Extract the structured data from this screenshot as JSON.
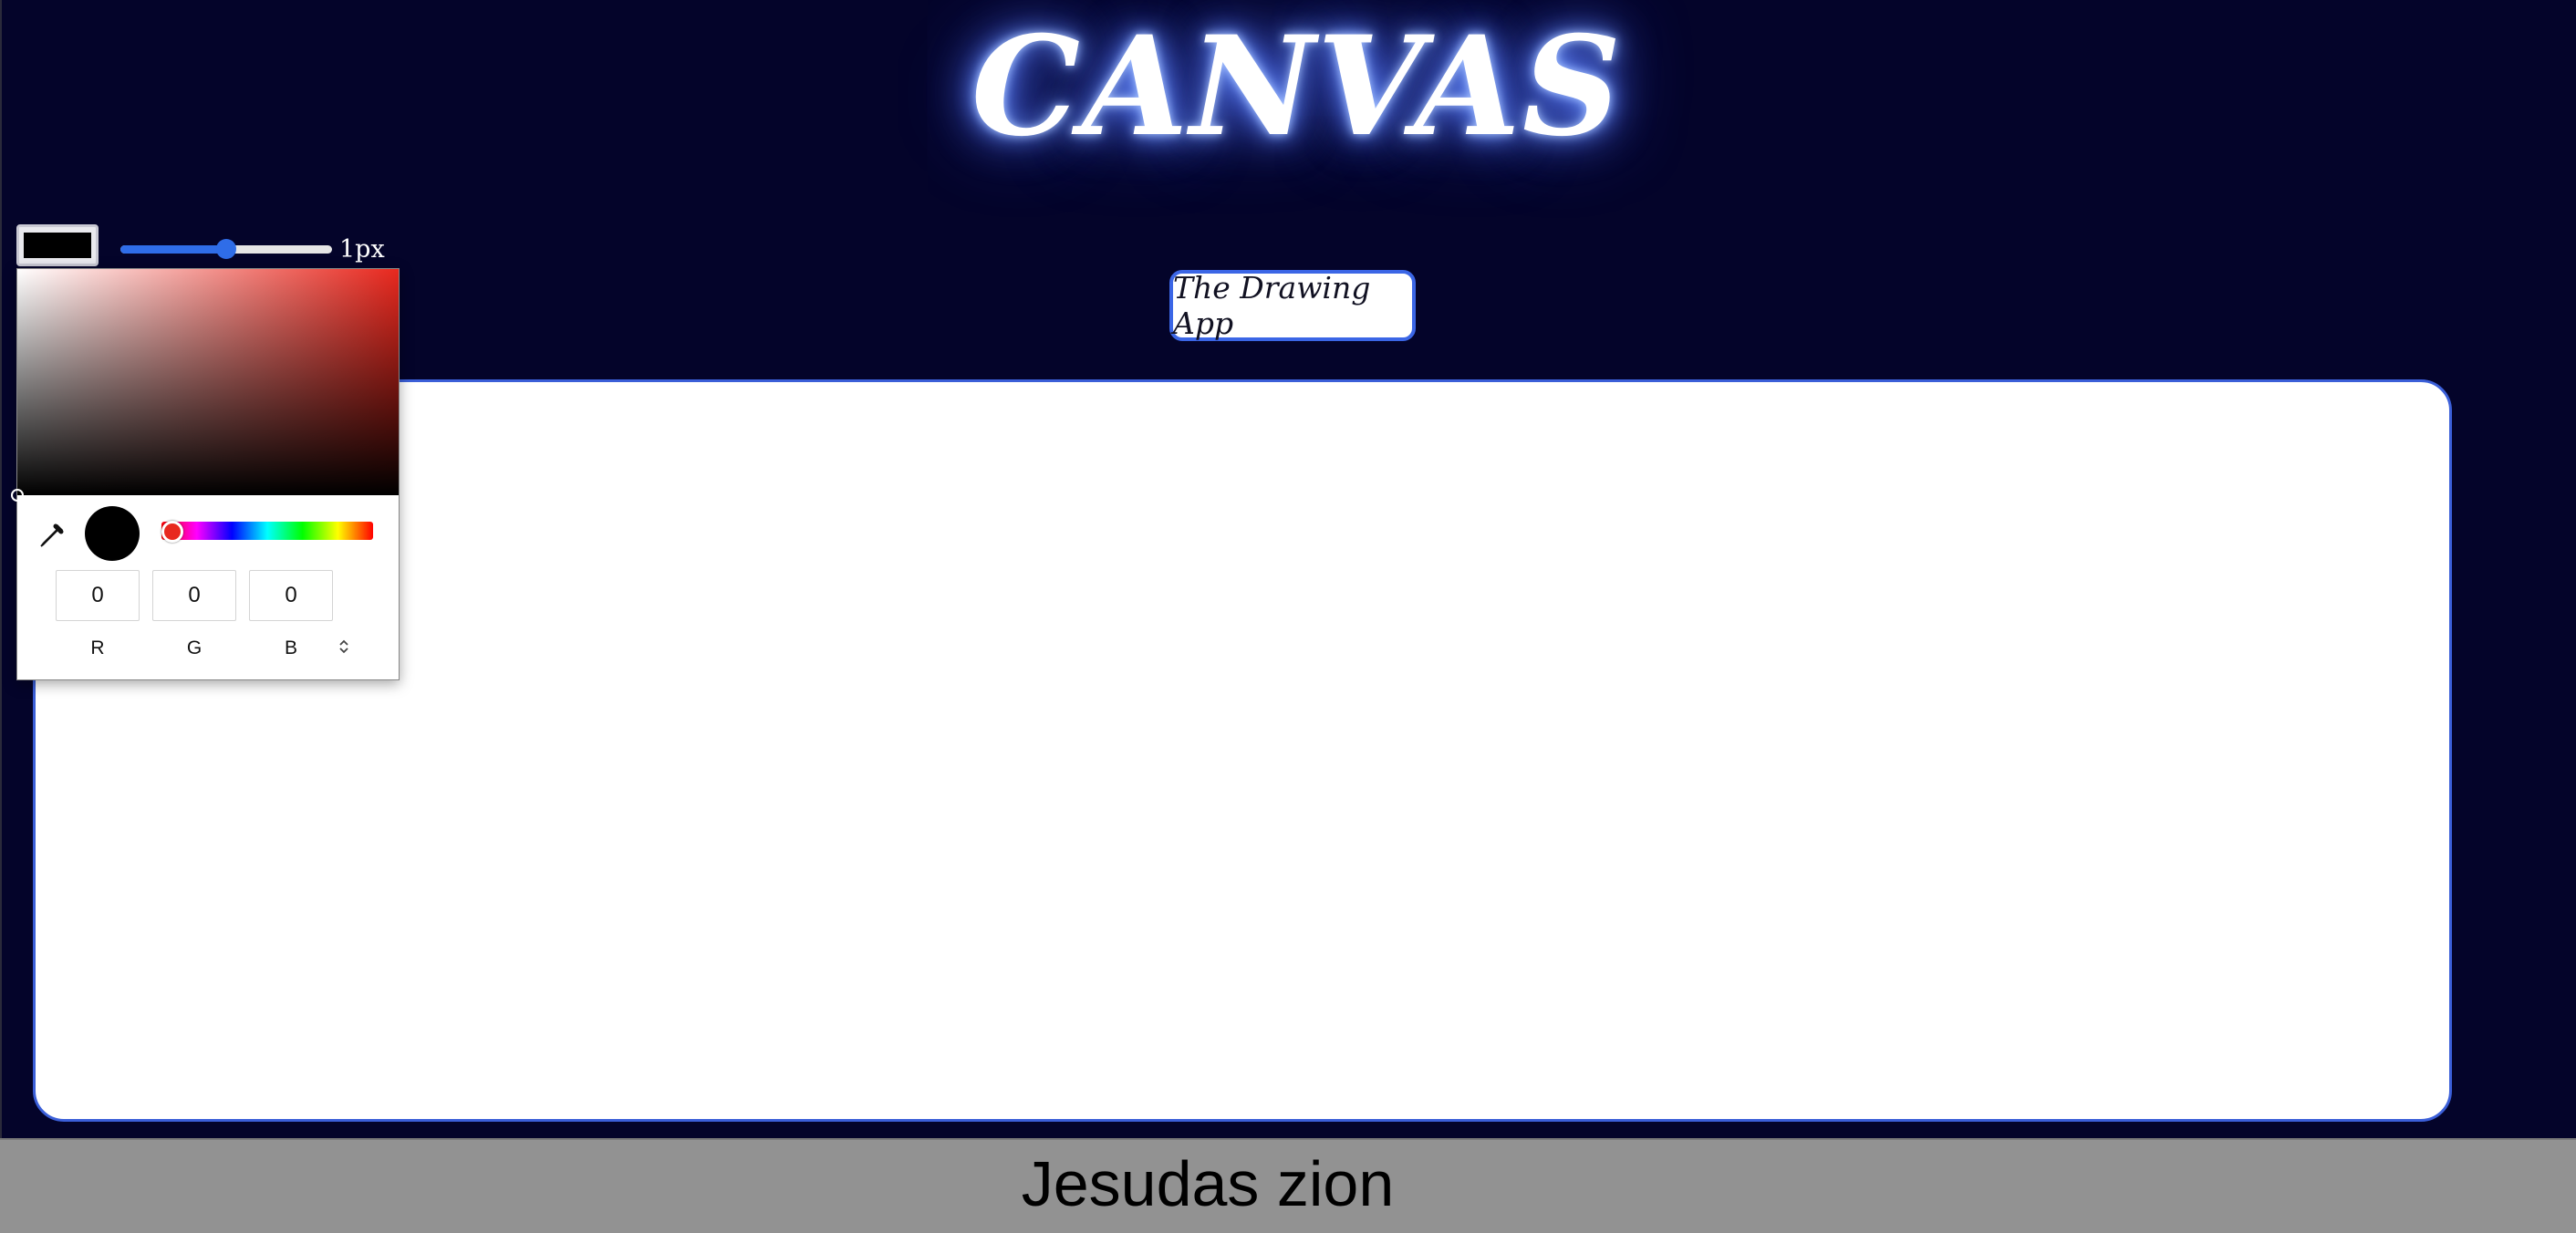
{
  "header": {
    "title": "CANVAS",
    "app_name": "The Drawing App"
  },
  "toolbar": {
    "current_color": "#000000",
    "brush_size_label": "1px",
    "brush_size_fraction": 0.5
  },
  "color_picker": {
    "hue_color": "#e8281e",
    "saturation": 0.0,
    "value": 0.0,
    "hue_fraction": 0.0,
    "preview_color": "#000000",
    "eyedropper_icon": "eyedropper-icon",
    "format_toggle_icon": "up-down-chevron-icon",
    "channels": [
      {
        "label": "R",
        "value": "0"
      },
      {
        "label": "G",
        "value": "0"
      },
      {
        "label": "B",
        "value": "0"
      }
    ]
  },
  "footer": {
    "text": "Jesudas zion"
  },
  "colors": {
    "background": "#04042a",
    "accent": "#3b66e6",
    "footer_bg": "#929292"
  }
}
